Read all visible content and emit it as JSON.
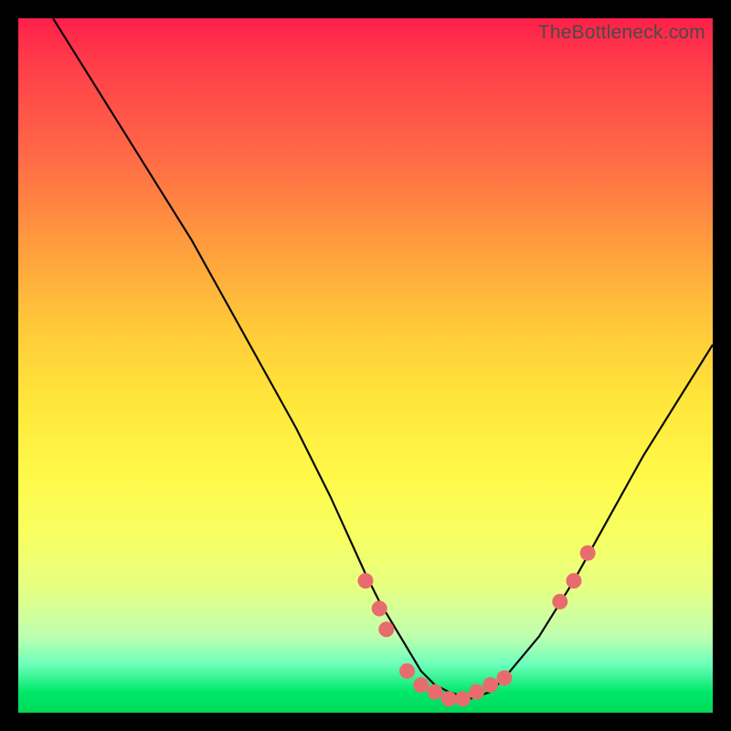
{
  "watermark": "TheBottleneck.com",
  "colors": {
    "curve": "#0a0a0a",
    "dot": "#e86c6e",
    "top": "#ff1f4a",
    "mid": "#ffe63a",
    "bottom": "#00d85a"
  },
  "chart_data": {
    "type": "line",
    "title": "",
    "xlabel": "",
    "ylabel": "",
    "xlim": [
      0,
      100
    ],
    "ylim": [
      0,
      100
    ],
    "grid": false,
    "legend": "none",
    "series": [
      {
        "name": "curve",
        "x": [
          5,
          10,
          15,
          20,
          25,
          30,
          35,
          40,
          45,
          50,
          52,
          55,
          58,
          60,
          62,
          65,
          68,
          70,
          75,
          80,
          85,
          90,
          95,
          100
        ],
        "y": [
          100,
          92,
          84,
          76,
          68,
          59,
          50,
          41,
          31,
          20,
          16,
          11,
          6,
          4,
          3,
          2,
          3,
          5,
          11,
          19,
          28,
          37,
          45,
          53
        ]
      }
    ],
    "markers": [
      {
        "x": 50,
        "y": 19
      },
      {
        "x": 52,
        "y": 15
      },
      {
        "x": 53,
        "y": 12
      },
      {
        "x": 56,
        "y": 6
      },
      {
        "x": 58,
        "y": 4
      },
      {
        "x": 60,
        "y": 3
      },
      {
        "x": 62,
        "y": 2
      },
      {
        "x": 64,
        "y": 2
      },
      {
        "x": 66,
        "y": 3
      },
      {
        "x": 68,
        "y": 4
      },
      {
        "x": 70,
        "y": 5
      },
      {
        "x": 78,
        "y": 16
      },
      {
        "x": 80,
        "y": 19
      },
      {
        "x": 82,
        "y": 23
      }
    ]
  }
}
